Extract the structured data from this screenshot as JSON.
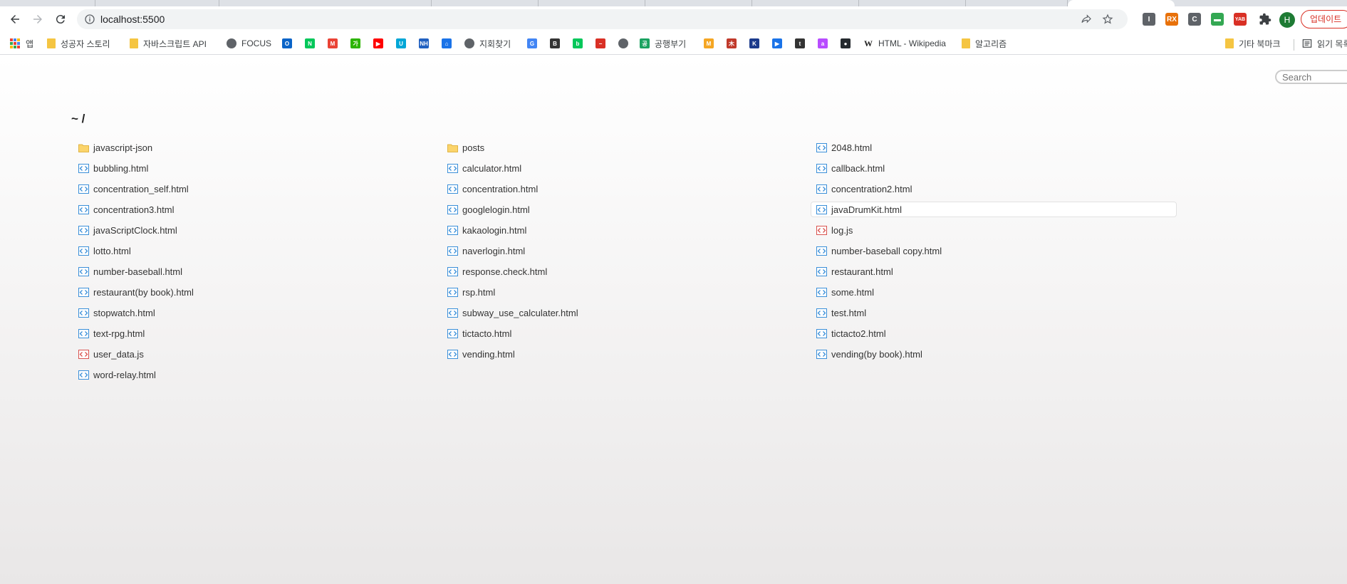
{
  "browser": {
    "url": "localhost:5500",
    "update_label": "업데이트",
    "profile_initial": "H",
    "extensions": [
      {
        "name": "extension-i-icon",
        "label": "I",
        "color": "#5f6368"
      },
      {
        "name": "extension-rx-icon",
        "label": "RX",
        "color": "#e8710a"
      },
      {
        "name": "extension-c-icon",
        "label": "C",
        "color": "#5f6368"
      },
      {
        "name": "extension-green-icon",
        "label": "▬",
        "color": "#34a853"
      },
      {
        "name": "extension-yab-icon",
        "label": "YAB",
        "color": "#d93025"
      }
    ]
  },
  "bookmarks": {
    "apps_label": "앱",
    "items": [
      {
        "label": "성공자 스토리",
        "icon": "folder"
      },
      {
        "label": "자바스크립트 API",
        "icon": "folder"
      },
      {
        "label": "FOCUS",
        "icon": "globe"
      },
      {
        "label": "",
        "icon": "outlook",
        "color": "#0a64c8",
        "glyph": "O"
      },
      {
        "label": "",
        "icon": "naver",
        "color": "#03c75a",
        "glyph": "N"
      },
      {
        "label": "",
        "icon": "gmail",
        "color": "#ea4335",
        "glyph": "M"
      },
      {
        "label": "",
        "icon": "ga",
        "color": "#2db400",
        "glyph": "가"
      },
      {
        "label": "",
        "icon": "youtube",
        "color": "#ff0000",
        "glyph": "▶"
      },
      {
        "label": "",
        "icon": "u",
        "color": "#00a6d6",
        "glyph": "U"
      },
      {
        "label": "",
        "icon": "nh",
        "color": "#2060c0",
        "glyph": "NH"
      },
      {
        "label": "",
        "icon": "house",
        "color": "#1a73e8",
        "glyph": "⌂"
      },
      {
        "label": "지회찾기",
        "icon": "globe"
      },
      {
        "label": "",
        "icon": "google",
        "color": "#4285f4",
        "glyph": "G"
      },
      {
        "label": "",
        "icon": "b",
        "color": "#333333",
        "glyph": "B"
      },
      {
        "label": "",
        "icon": "blog",
        "color": "#03c75a",
        "glyph": "b"
      },
      {
        "label": "",
        "icon": "minus",
        "color": "#d93025",
        "glyph": "−"
      },
      {
        "label": "",
        "icon": "globe2",
        "color": "#5f6368",
        "glyph": ""
      },
      {
        "label": "공행부기",
        "icon": "green",
        "color": "#1aa260",
        "glyph": "공"
      },
      {
        "label": "",
        "icon": "m",
        "color": "#f5a623",
        "glyph": "M"
      },
      {
        "label": "",
        "icon": "ant",
        "color": "#c0392b",
        "glyph": "木"
      },
      {
        "label": "",
        "icon": "k",
        "color": "#1b3a8c",
        "glyph": "K"
      },
      {
        "label": "",
        "icon": "play",
        "color": "#1a73e8",
        "glyph": "▶"
      },
      {
        "label": "",
        "icon": "t",
        "color": "#333333",
        "glyph": "t"
      },
      {
        "label": "",
        "icon": "a",
        "color": "#b84cff",
        "glyph": "a"
      },
      {
        "label": "",
        "icon": "github",
        "color": "#24292e",
        "glyph": "●"
      },
      {
        "label": "HTML - Wikipedia",
        "icon": "wiki",
        "color": "#ffffff",
        "glyph": "W"
      },
      {
        "label": "알고리즘",
        "icon": "folder"
      }
    ],
    "other_label": "기타 북마크",
    "reading_label": "읽기 목록"
  },
  "page": {
    "search_placeholder": "Search",
    "breadcrumb": "~ /",
    "columns": [
      [
        {
          "name": "javascript-json",
          "type": "folder"
        },
        {
          "name": "bubbling.html",
          "type": "html"
        },
        {
          "name": "concentration_self.html",
          "type": "html"
        },
        {
          "name": "concentration3.html",
          "type": "html"
        },
        {
          "name": "javaScriptClock.html",
          "type": "html"
        },
        {
          "name": "lotto.html",
          "type": "html"
        },
        {
          "name": "number-baseball.html",
          "type": "html"
        },
        {
          "name": "restaurant(by book).html",
          "type": "html"
        },
        {
          "name": "stopwatch.html",
          "type": "html"
        },
        {
          "name": "text-rpg.html",
          "type": "html"
        },
        {
          "name": "user_data.js",
          "type": "js"
        },
        {
          "name": "word-relay.html",
          "type": "html"
        }
      ],
      [
        {
          "name": "posts",
          "type": "folder"
        },
        {
          "name": "calculator.html",
          "type": "html"
        },
        {
          "name": "concentration.html",
          "type": "html"
        },
        {
          "name": "googlelogin.html",
          "type": "html"
        },
        {
          "name": "kakaologin.html",
          "type": "html"
        },
        {
          "name": "naverlogin.html",
          "type": "html"
        },
        {
          "name": "response.check.html",
          "type": "html"
        },
        {
          "name": "rsp.html",
          "type": "html"
        },
        {
          "name": "subway_use_calculater.html",
          "type": "html"
        },
        {
          "name": "tictacto.html",
          "type": "html"
        },
        {
          "name": "vending.html",
          "type": "html"
        }
      ],
      [
        {
          "name": "2048.html",
          "type": "html"
        },
        {
          "name": "callback.html",
          "type": "html"
        },
        {
          "name": "concentration2.html",
          "type": "html"
        },
        {
          "name": "javaDrumKit.html",
          "type": "html",
          "highlighted": true
        },
        {
          "name": "log.js",
          "type": "js"
        },
        {
          "name": "number-baseball copy.html",
          "type": "html"
        },
        {
          "name": "restaurant.html",
          "type": "html"
        },
        {
          "name": "some.html",
          "type": "html"
        },
        {
          "name": "test.html",
          "type": "html"
        },
        {
          "name": "tictacto2.html",
          "type": "html"
        },
        {
          "name": "vending(by book).html",
          "type": "html"
        }
      ]
    ]
  }
}
